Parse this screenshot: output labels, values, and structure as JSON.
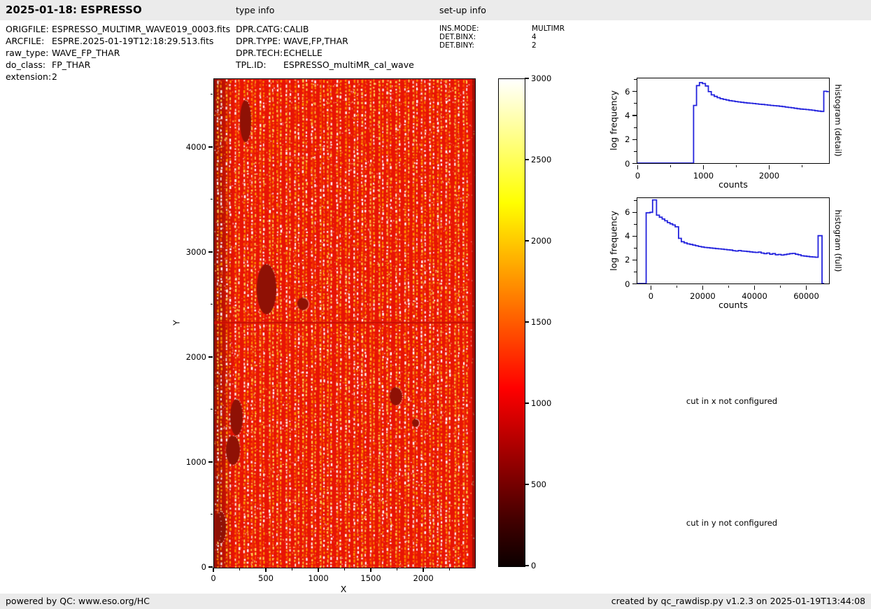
{
  "header": {
    "title": "2025-01-18: ESPRESSO",
    "type_info_label": "type info",
    "setup_info_label": "set-up info"
  },
  "file_info": {
    "rows": [
      {
        "label": "ORIGFILE:",
        "value": "ESPRESSO_MULTIMR_WAVE019_0003.fits"
      },
      {
        "label": "ARCFILE:",
        "value": "ESPRE.2025-01-19T12:18:29.513.fits"
      },
      {
        "label": "raw_type:",
        "value": "WAVE_FP_THAR"
      },
      {
        "label": "do_class:",
        "value": "FP_THAR"
      },
      {
        "label": "extension:",
        "value": "2"
      }
    ]
  },
  "type_info": {
    "rows": [
      {
        "label": "DPR.CATG:",
        "value": "CALIB"
      },
      {
        "label": "DPR.TYPE:",
        "value": "WAVE,FP,THAR"
      },
      {
        "label": "DPR.TECH:",
        "value": "ECHELLE"
      },
      {
        "label": "TPL.ID:",
        "value": "ESPRESSO_multiMR_cal_wave"
      }
    ]
  },
  "setup_info": {
    "rows": [
      {
        "label": "INS.MODE:",
        "value": "MULTIMR"
      },
      {
        "label": "DET.BINX:",
        "value": "4"
      },
      {
        "label": "DET.BINY:",
        "value": "2"
      }
    ]
  },
  "messages": {
    "cut_x": "cut in x not configured",
    "cut_y": "cut in y not configured"
  },
  "footer": {
    "left": "powered by QC: www.eso.org/HC",
    "right": "created by qc_rawdisp.py v1.2.3 on 2025-01-19T13:44:08"
  },
  "colors": {
    "line_blue": "#2323dd",
    "bar_bg": "#ebebeb",
    "heat_red": "#e81405",
    "heat_dark": "#8f1105",
    "stripe_orange": "#ff9a00",
    "stripe_yellow": "#ffd24d",
    "stripe_white": "#ffffff"
  },
  "chart_data": [
    {
      "type": "heatmap",
      "title": "",
      "xlabel": "X",
      "ylabel": "Y",
      "xlim": [
        0,
        2486
      ],
      "ylim": [
        0,
        4653
      ],
      "xticks": [
        0,
        500,
        1000,
        1500,
        2000
      ],
      "xticks_minor": [
        250,
        750,
        1250,
        1750,
        2250
      ],
      "yticks": [
        0,
        1000,
        2000,
        3000,
        4000
      ],
      "yticks_minor": [
        500,
        1500,
        2500,
        3500,
        4500
      ],
      "colormap": "hot",
      "value_range": [
        0,
        3000
      ],
      "colorbar_ticks": [
        0,
        500,
        1000,
        1500,
        2000,
        2500,
        3000
      ],
      "description": "raw FP/ThAr echelle frame: bright red background with dotted yellow/white vertical order stripes, dark half-disc defects near left edge, detector gap line at mid height"
    },
    {
      "type": "line",
      "xlabel": "counts",
      "ylabel": "log frequency",
      "right_label": "histogram (detail)",
      "xlim": [
        0,
        2915
      ],
      "ylim": [
        0,
        7.05
      ],
      "xticks": [
        0,
        1000,
        2000
      ],
      "xticks_minor": [
        500,
        1500,
        2500
      ],
      "yticks": [
        0,
        2,
        4,
        6
      ],
      "yticks_minor": [
        1,
        3,
        5,
        7
      ],
      "grid": false,
      "bins": [
        [
          0,
          0
        ],
        [
          855,
          4.8
        ],
        [
          900,
          6.45
        ],
        [
          945,
          6.7
        ],
        [
          990,
          6.62
        ],
        [
          1035,
          6.42
        ],
        [
          1080,
          5.95
        ],
        [
          1125,
          5.68
        ],
        [
          1170,
          5.55
        ],
        [
          1215,
          5.45
        ],
        [
          1260,
          5.36
        ],
        [
          1305,
          5.3
        ],
        [
          1350,
          5.25
        ],
        [
          1395,
          5.2
        ],
        [
          1440,
          5.16
        ],
        [
          1485,
          5.12
        ],
        [
          1530,
          5.09
        ],
        [
          1575,
          5.06
        ],
        [
          1620,
          5.03
        ],
        [
          1665,
          5.0
        ],
        [
          1710,
          4.98
        ],
        [
          1755,
          4.96
        ],
        [
          1800,
          4.93
        ],
        [
          1845,
          4.9
        ],
        [
          1890,
          4.88
        ],
        [
          1935,
          4.86
        ],
        [
          1980,
          4.83
        ],
        [
          2025,
          4.8
        ],
        [
          2070,
          4.78
        ],
        [
          2115,
          4.76
        ],
        [
          2160,
          4.73
        ],
        [
          2205,
          4.7
        ],
        [
          2250,
          4.66
        ],
        [
          2295,
          4.63
        ],
        [
          2340,
          4.6
        ],
        [
          2385,
          4.56
        ],
        [
          2430,
          4.53
        ],
        [
          2475,
          4.5
        ],
        [
          2520,
          4.48
        ],
        [
          2565,
          4.46
        ],
        [
          2610,
          4.43
        ],
        [
          2655,
          4.4
        ],
        [
          2700,
          4.36
        ],
        [
          2745,
          4.33
        ],
        [
          2790,
          4.3
        ],
        [
          2835,
          5.98
        ],
        [
          2880,
          5.95
        ]
      ],
      "bins_end": 2912
    },
    {
      "type": "line",
      "xlabel": "counts",
      "ylabel": "log frequency",
      "right_label": "histogram (full)",
      "xlim": [
        -5100,
        68900
      ],
      "ylim": [
        0,
        7.15
      ],
      "xticks": [
        0,
        20000,
        40000,
        60000
      ],
      "xticks_minor": [
        10000,
        30000,
        50000
      ],
      "yticks": [
        0,
        2,
        4,
        6
      ],
      "yticks_minor": [
        1,
        3,
        5,
        7
      ],
      "grid": false,
      "bins": [
        [
          -5100,
          0
        ],
        [
          -1700,
          5.92
        ],
        [
          -200,
          5.96
        ],
        [
          800,
          7.0
        ],
        [
          2300,
          5.72
        ],
        [
          3400,
          5.55
        ],
        [
          4500,
          5.4
        ],
        [
          5500,
          5.25
        ],
        [
          6500,
          5.1
        ],
        [
          7500,
          5.0
        ],
        [
          8500,
          4.9
        ],
        [
          9500,
          4.75
        ],
        [
          10800,
          3.78
        ],
        [
          11900,
          3.5
        ],
        [
          13000,
          3.4
        ],
        [
          14100,
          3.32
        ],
        [
          15200,
          3.27
        ],
        [
          16300,
          3.22
        ],
        [
          17400,
          3.16
        ],
        [
          18500,
          3.1
        ],
        [
          19600,
          3.06
        ],
        [
          20700,
          3.02
        ],
        [
          21800,
          3.0
        ],
        [
          22900,
          2.97
        ],
        [
          24000,
          2.95
        ],
        [
          25100,
          2.92
        ],
        [
          26200,
          2.9
        ],
        [
          27300,
          2.88
        ],
        [
          28400,
          2.85
        ],
        [
          29500,
          2.82
        ],
        [
          30600,
          2.8
        ],
        [
          31700,
          2.75
        ],
        [
          32800,
          2.72
        ],
        [
          33900,
          2.76
        ],
        [
          35000,
          2.72
        ],
        [
          36100,
          2.7
        ],
        [
          37200,
          2.68
        ],
        [
          38300,
          2.65
        ],
        [
          39400,
          2.62
        ],
        [
          40500,
          2.6
        ],
        [
          41600,
          2.63
        ],
        [
          42700,
          2.55
        ],
        [
          43800,
          2.5
        ],
        [
          44900,
          2.55
        ],
        [
          46000,
          2.45
        ],
        [
          47100,
          2.5
        ],
        [
          48200,
          2.4
        ],
        [
          49300,
          2.43
        ],
        [
          50400,
          2.38
        ],
        [
          51500,
          2.42
        ],
        [
          52600,
          2.46
        ],
        [
          53700,
          2.5
        ],
        [
          54800,
          2.52
        ],
        [
          55900,
          2.45
        ],
        [
          57000,
          2.4
        ],
        [
          58100,
          2.32
        ],
        [
          59200,
          2.3
        ],
        [
          60300,
          2.27
        ],
        [
          61400,
          2.24
        ],
        [
          62500,
          2.22
        ],
        [
          63600,
          2.2
        ],
        [
          64700,
          4.0
        ],
        [
          66200,
          0
        ]
      ],
      "bins_end": 67000
    }
  ]
}
